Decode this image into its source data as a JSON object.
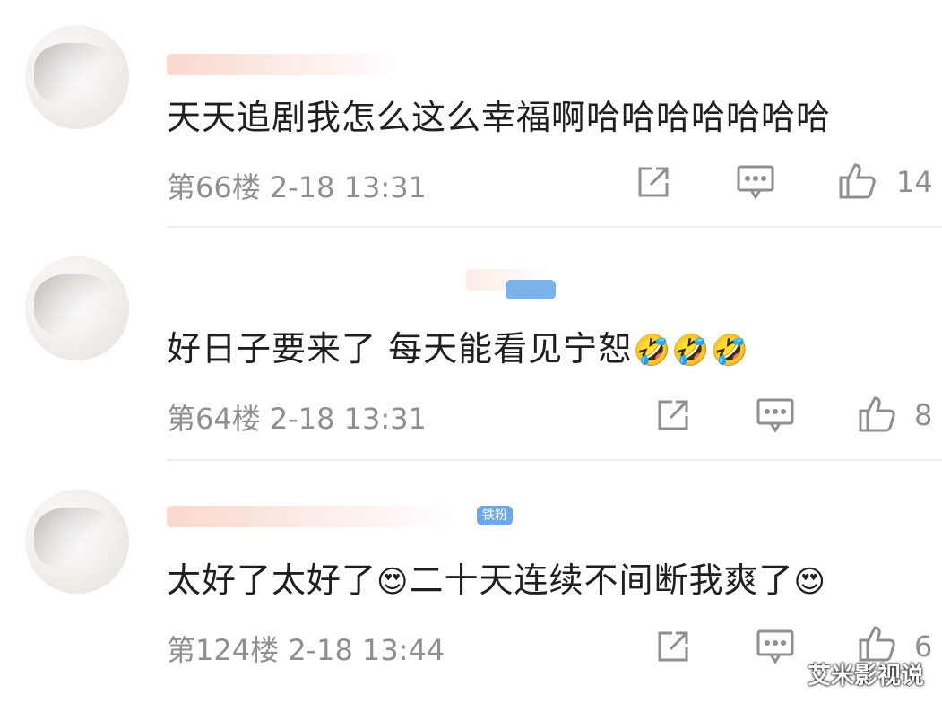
{
  "comments": [
    {
      "text": "天天追剧我怎么这么幸福啊哈哈哈哈哈哈哈",
      "emojis": "",
      "floor_time": "第66楼 2-18 13:31",
      "likes": "14"
    },
    {
      "text": "好日子要来了 每天能看见宁恕",
      "emojis": "🤣🤣🤣",
      "floor_time": "第64楼 2-18 13:31",
      "likes": "8"
    },
    {
      "text": "太好了太好了",
      "emoji_mid": "😍",
      "text2": "二十天连续不间断我爽了",
      "emojis": "😍",
      "badge": "铁粉",
      "floor_time": "第124楼 2-18 13:44",
      "likes": "6"
    }
  ],
  "watermark": "艾米影视说",
  "icons": {
    "share": "share-icon",
    "comment": "comment-icon",
    "like": "thumbs-up-icon"
  }
}
